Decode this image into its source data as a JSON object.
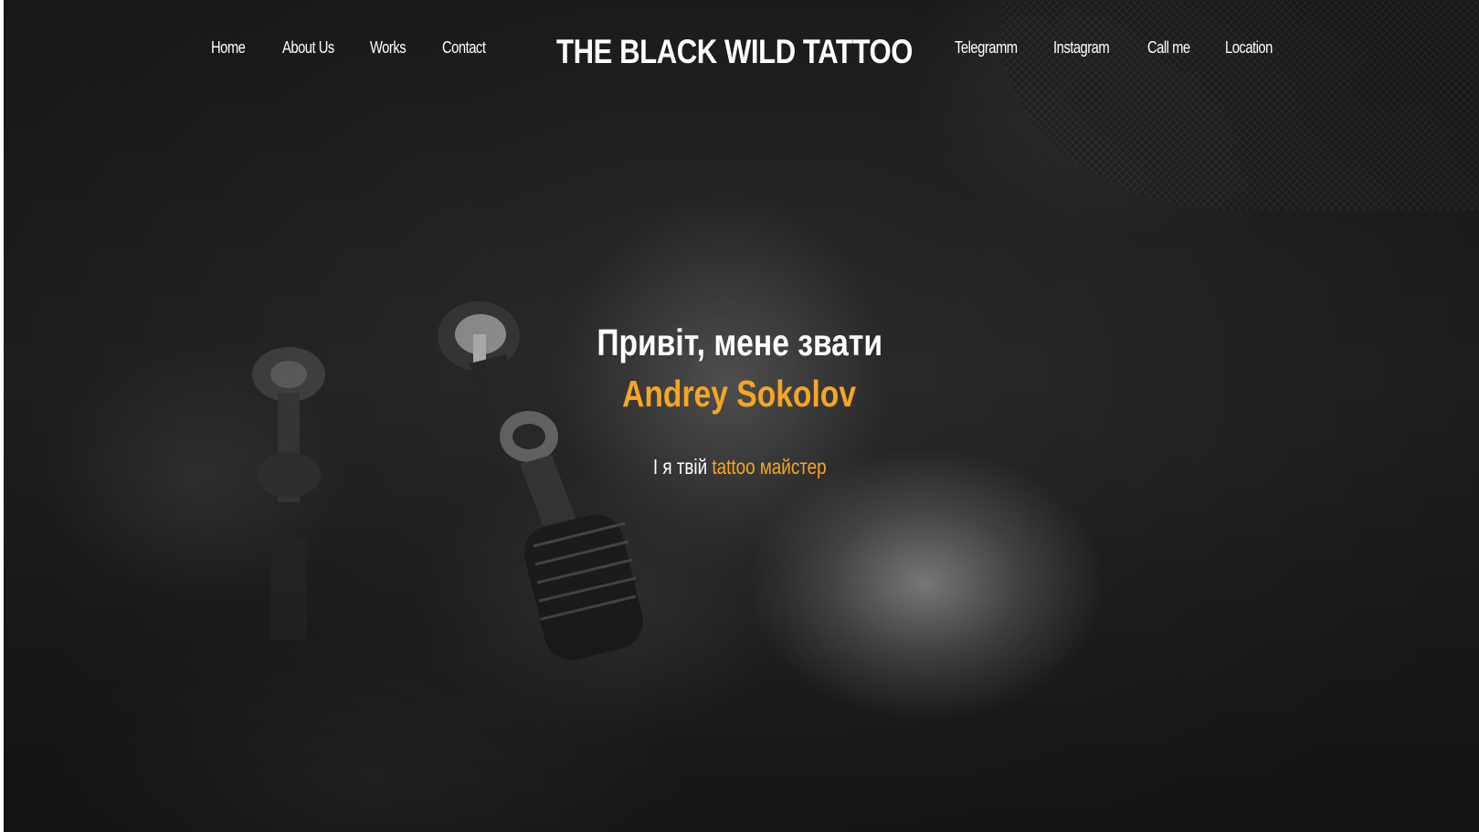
{
  "nav": {
    "left": [
      {
        "label": "Home"
      },
      {
        "label": "About Us"
      },
      {
        "label": "Works"
      },
      {
        "label": "Contact"
      }
    ],
    "brand": "THE BLACK WILD TATTOO",
    "right": [
      {
        "label": "Telegramm"
      },
      {
        "label": "Instagram"
      },
      {
        "label": "Call me"
      },
      {
        "label": "Location"
      }
    ]
  },
  "hero": {
    "greeting": "Привіт, мене звати",
    "name": "Andrey Sokolov",
    "tagline_prefix": "І я твій",
    "tagline_accent": "tattoo майстер",
    "background_image": "grayscale photo of tattoo artist holding tattoo machine"
  },
  "colors": {
    "accent": "#f5a623",
    "text": "#ffffff",
    "background": "#252525"
  }
}
